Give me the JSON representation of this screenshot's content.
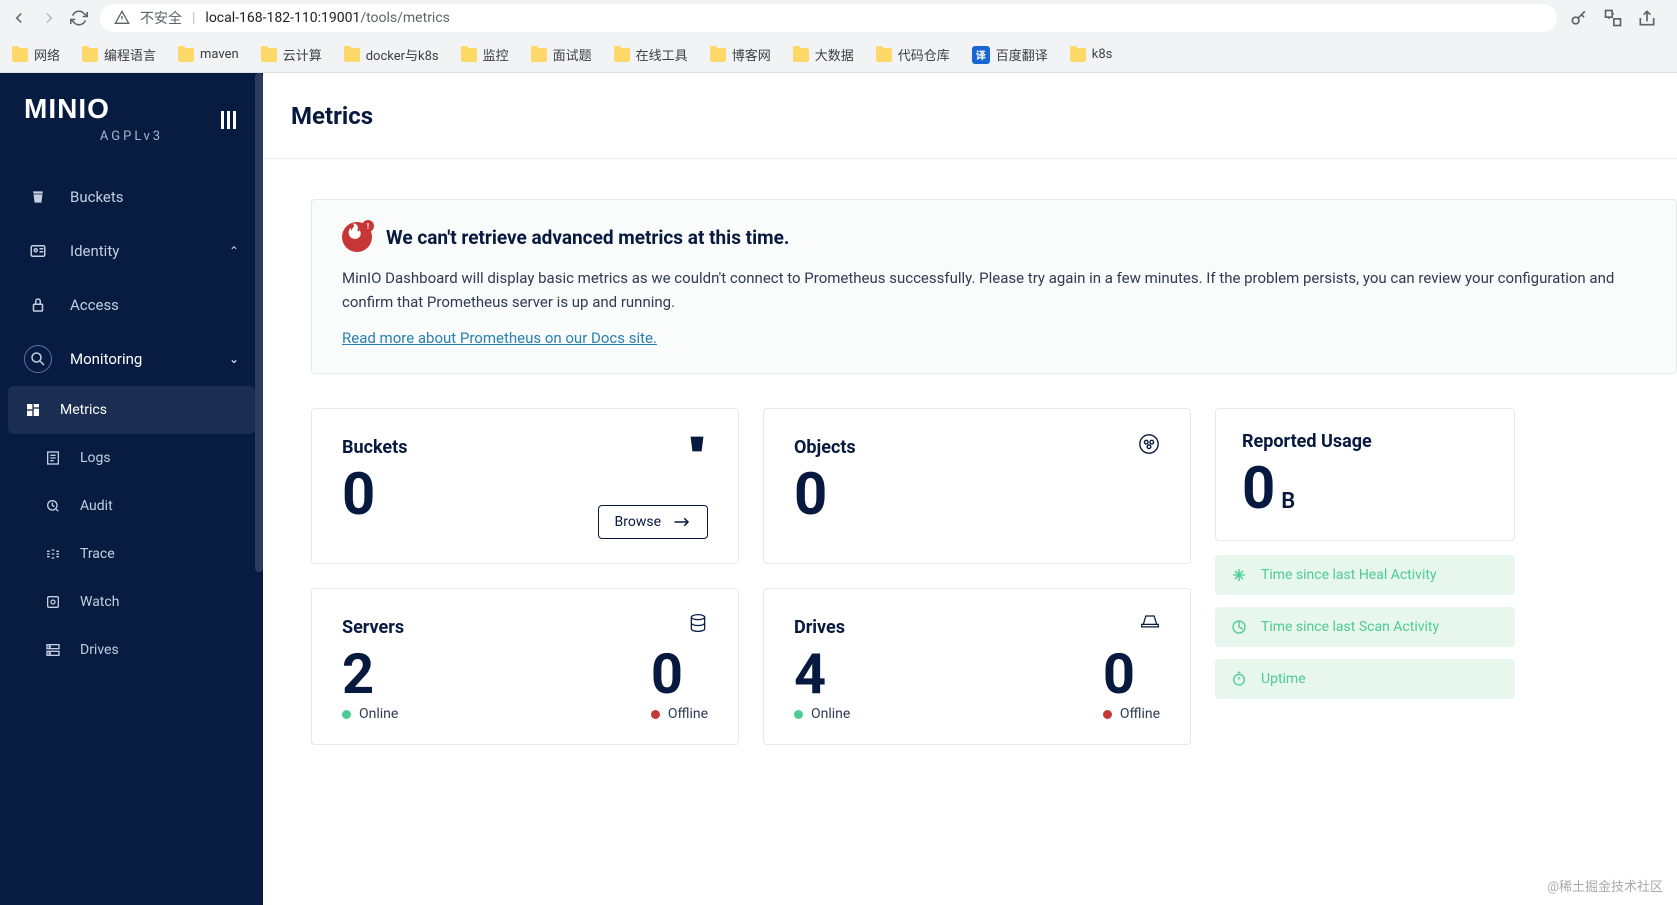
{
  "browser": {
    "insecure_label": "不安全",
    "url_host": "local-168-182-110:19001",
    "url_path": "/tools/metrics",
    "bookmarks": [
      {
        "label": "网络",
        "type": "folder"
      },
      {
        "label": "编程语言",
        "type": "folder"
      },
      {
        "label": "maven",
        "type": "folder"
      },
      {
        "label": "云计算",
        "type": "folder"
      },
      {
        "label": "docker与k8s",
        "type": "folder"
      },
      {
        "label": "监控",
        "type": "folder"
      },
      {
        "label": "面试题",
        "type": "folder"
      },
      {
        "label": "在线工具",
        "type": "folder"
      },
      {
        "label": "博客网",
        "type": "folder"
      },
      {
        "label": "大数据",
        "type": "folder"
      },
      {
        "label": "代码仓库",
        "type": "folder"
      },
      {
        "label": "百度翻译",
        "type": "badge"
      },
      {
        "label": "k8s",
        "type": "folder"
      }
    ]
  },
  "brand": {
    "name": "MINIO",
    "license": "AGPLv3"
  },
  "sidebar": {
    "items": [
      {
        "label": "Buckets",
        "icon": "bucket"
      },
      {
        "label": "Identity",
        "icon": "identity",
        "expand": "up"
      },
      {
        "label": "Access",
        "icon": "lock"
      },
      {
        "label": "Monitoring",
        "icon": "search",
        "expand": "down",
        "selected": true,
        "children": [
          {
            "label": "Metrics",
            "icon": "dashboard",
            "active": true
          },
          {
            "label": "Logs",
            "icon": "logs"
          },
          {
            "label": "Audit",
            "icon": "audit"
          },
          {
            "label": "Trace",
            "icon": "trace"
          },
          {
            "label": "Watch",
            "icon": "watch"
          },
          {
            "label": "Drives",
            "icon": "drives"
          }
        ]
      }
    ]
  },
  "page": {
    "title": "Metrics"
  },
  "alert": {
    "title": "We can't retrieve advanced metrics at this time.",
    "body": "MinIO Dashboard will display basic metrics as we couldn't connect to Prometheus successfully. Please try again in a few minutes. If the problem persists, you can review your configuration and confirm that Prometheus server is up and running.",
    "link": "Read more about Prometheus on our Docs site."
  },
  "cards": {
    "buckets": {
      "title": "Buckets",
      "value": "0",
      "browse": "Browse"
    },
    "objects": {
      "title": "Objects",
      "value": "0"
    },
    "servers": {
      "title": "Servers",
      "online": "2",
      "offline": "0",
      "online_label": "Online",
      "offline_label": "Offline"
    },
    "drives": {
      "title": "Drives",
      "online": "4",
      "offline": "0",
      "online_label": "Online",
      "offline_label": "Offline"
    },
    "usage": {
      "title": "Reported Usage",
      "value": "0",
      "unit": "B"
    },
    "activities": [
      {
        "label": "Time since last Heal Activity",
        "icon": "heal"
      },
      {
        "label": "Time since last Scan Activity",
        "icon": "scan"
      },
      {
        "label": "Uptime",
        "icon": "uptime"
      }
    ]
  },
  "watermark": "@稀土掘金技术社区"
}
